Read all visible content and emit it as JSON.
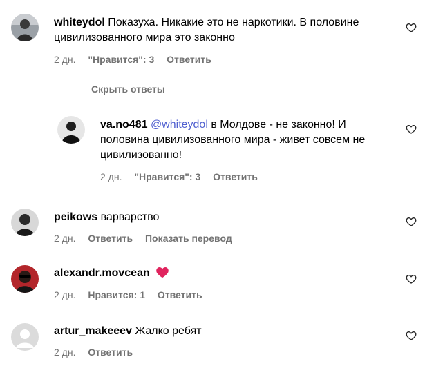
{
  "comments": [
    {
      "username": "whiteydol",
      "text": "Показуха. Никакие это не наркотики. В половине цивилизованного мира это законно",
      "time": "2 дн.",
      "likes": "\"Нравится\": 3",
      "reply": "Ответить"
    },
    {
      "username": "peikows",
      "text": "варварство",
      "time": "2 дн.",
      "reply": "Ответить",
      "translate": "Показать перевод"
    },
    {
      "username": "alexandr.movcean",
      "text": "",
      "emoji": "red-heart-emoji",
      "time": "2 дн.",
      "likes": "Нравится: 1",
      "reply": "Ответить"
    },
    {
      "username": "artur_makeeev",
      "text": "Жалко ребят",
      "time": "2 дн.",
      "reply": "Ответить"
    }
  ],
  "replies_toggle": "Скрыть ответы",
  "reply": {
    "username": "va.no481",
    "mention": "@whiteydol",
    "text": " в Молдове - не законно! И половина цивилизованного мира - живет совсем не цивилизованно!",
    "time": "2 дн.",
    "likes": "\"Нравится\": 3",
    "reply": "Ответить"
  },
  "icons": {
    "like": "heart-outline-icon",
    "default_avatar": "default-avatar-icon"
  },
  "colors": {
    "meta_text": "#737373",
    "mention": "#4f5fd0",
    "heart_emoji": "#e0245e"
  }
}
